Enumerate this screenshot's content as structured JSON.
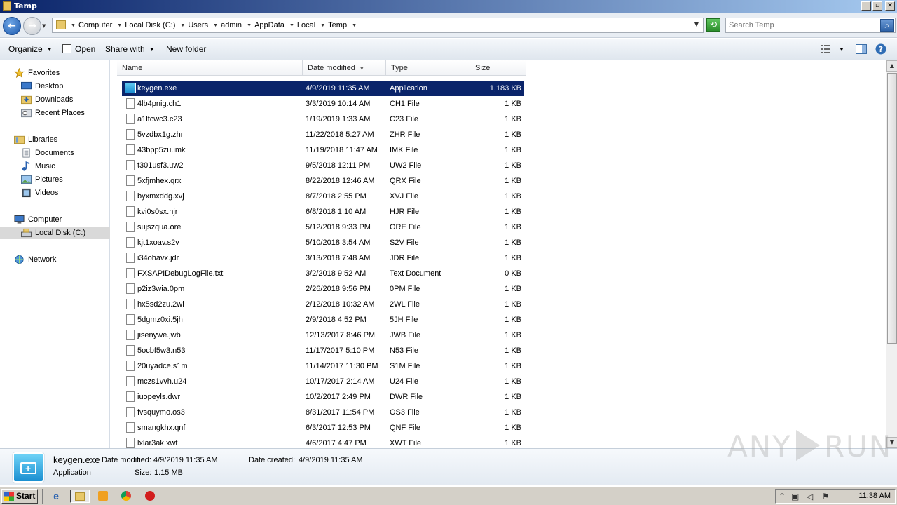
{
  "window": {
    "title": "Temp"
  },
  "address": {
    "crumbs": [
      "Computer",
      "Local Disk (C:)",
      "Users",
      "admin",
      "AppData",
      "Local",
      "Temp"
    ]
  },
  "search": {
    "placeholder": "Search Temp"
  },
  "toolbar": {
    "organize": "Organize",
    "open": "Open",
    "share_with": "Share with",
    "new_folder": "New folder"
  },
  "nav": {
    "favorites": "Favorites",
    "desktop": "Desktop",
    "downloads": "Downloads",
    "recent_places": "Recent Places",
    "libraries": "Libraries",
    "documents": "Documents",
    "music": "Music",
    "pictures": "Pictures",
    "videos": "Videos",
    "computer": "Computer",
    "local_disk": "Local Disk (C:)",
    "network": "Network"
  },
  "columns": {
    "name": "Name",
    "date_modified": "Date modified",
    "type": "Type",
    "size": "Size"
  },
  "files": [
    {
      "name": "keygen.exe",
      "date": "4/9/2019 11:35 AM",
      "type": "Application",
      "size": "1,183 KB"
    },
    {
      "name": "4lb4pnig.ch1",
      "date": "3/3/2019 10:14 AM",
      "type": "CH1 File",
      "size": "1 KB"
    },
    {
      "name": "a1lfcwc3.c23",
      "date": "1/19/2019 1:33 AM",
      "type": "C23 File",
      "size": "1 KB"
    },
    {
      "name": "5vzdbx1g.zhr",
      "date": "11/22/2018 5:27 AM",
      "type": "ZHR File",
      "size": "1 KB"
    },
    {
      "name": "43bpp5zu.imk",
      "date": "11/19/2018 11:47 AM",
      "type": "IMK File",
      "size": "1 KB"
    },
    {
      "name": "t301usf3.uw2",
      "date": "9/5/2018 12:11 PM",
      "type": "UW2 File",
      "size": "1 KB"
    },
    {
      "name": "5xfjmhex.qrx",
      "date": "8/22/2018 12:46 AM",
      "type": "QRX File",
      "size": "1 KB"
    },
    {
      "name": "byxmxddg.xvj",
      "date": "8/7/2018 2:55 PM",
      "type": "XVJ File",
      "size": "1 KB"
    },
    {
      "name": "kvi0s0sx.hjr",
      "date": "6/8/2018 1:10 AM",
      "type": "HJR File",
      "size": "1 KB"
    },
    {
      "name": "sujszqua.ore",
      "date": "5/12/2018 9:33 PM",
      "type": "ORE File",
      "size": "1 KB"
    },
    {
      "name": "kjt1xoav.s2v",
      "date": "5/10/2018 3:54 AM",
      "type": "S2V File",
      "size": "1 KB"
    },
    {
      "name": "i34ohavx.jdr",
      "date": "3/13/2018 7:48 AM",
      "type": "JDR File",
      "size": "1 KB"
    },
    {
      "name": "FXSAPIDebugLogFile.txt",
      "date": "3/2/2018 9:52 AM",
      "type": "Text Document",
      "size": "0 KB"
    },
    {
      "name": "p2iz3wia.0pm",
      "date": "2/26/2018 9:56 PM",
      "type": "0PM File",
      "size": "1 KB"
    },
    {
      "name": "hx5sd2zu.2wl",
      "date": "2/12/2018 10:32 AM",
      "type": "2WL File",
      "size": "1 KB"
    },
    {
      "name": "5dgmz0xi.5jh",
      "date": "2/9/2018 4:52 PM",
      "type": "5JH File",
      "size": "1 KB"
    },
    {
      "name": "jisenywe.jwb",
      "date": "12/13/2017 8:46 PM",
      "type": "JWB File",
      "size": "1 KB"
    },
    {
      "name": "5ocbf5w3.n53",
      "date": "11/17/2017 5:10 PM",
      "type": "N53 File",
      "size": "1 KB"
    },
    {
      "name": "20uyadce.s1m",
      "date": "11/14/2017 11:30 PM",
      "type": "S1M File",
      "size": "1 KB"
    },
    {
      "name": "mczs1vvh.u24",
      "date": "10/17/2017 2:14 AM",
      "type": "U24 File",
      "size": "1 KB"
    },
    {
      "name": "iuopeyls.dwr",
      "date": "10/2/2017 2:49 PM",
      "type": "DWR File",
      "size": "1 KB"
    },
    {
      "name": "fvsquymo.os3",
      "date": "8/31/2017 11:54 PM",
      "type": "OS3 File",
      "size": "1 KB"
    },
    {
      "name": "smangkhx.qnf",
      "date": "6/3/2017 12:53 PM",
      "type": "QNF File",
      "size": "1 KB"
    },
    {
      "name": "lxlar3ak.xwt",
      "date": "4/6/2017 4:47 PM",
      "type": "XWT File",
      "size": "1 KB"
    }
  ],
  "details": {
    "name": "keygen.exe",
    "type": "Application",
    "date_modified_label": "Date modified:",
    "date_modified": "4/9/2019 11:35 AM",
    "size_label": "Size:",
    "size": "1.15 MB",
    "date_created_label": "Date created:",
    "date_created": "4/9/2019 11:35 AM"
  },
  "watermark": {
    "left": "ANY",
    "right": "RUN"
  },
  "taskbar": {
    "start": "Start",
    "clock": "11:38 AM"
  }
}
